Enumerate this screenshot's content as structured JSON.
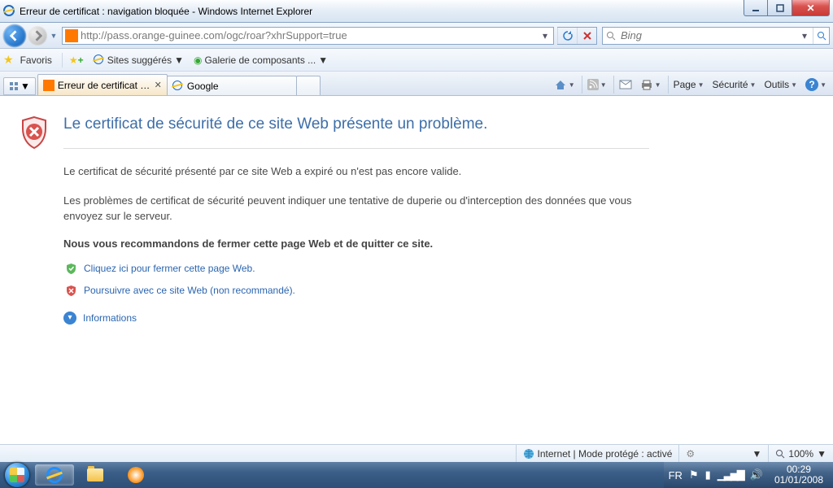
{
  "window": {
    "title": "Erreur de certificat : navigation bloquée - Windows Internet Explorer"
  },
  "nav": {
    "url": "http://pass.orange-guinee.com/ogc/roar?xhrSupport=true",
    "search_placeholder": "Bing"
  },
  "favorites": {
    "label": "Favoris",
    "suggested": "Sites suggérés",
    "gallery": "Galerie de composants ..."
  },
  "tabs": {
    "active": "Erreur de certificat : nav...",
    "second": "Google"
  },
  "commands": {
    "page": "Page",
    "security": "Sécurité",
    "tools": "Outils"
  },
  "cert": {
    "heading": "Le certificat de sécurité de ce site Web présente un problème.",
    "p1": "Le certificat de sécurité présenté par ce site Web a expiré ou n'est pas encore valide.",
    "p2": "Les problèmes de certificat de sécurité peuvent indiquer une tentative de duperie ou d'interception des données que vous envoyez sur le serveur.",
    "recommend": "Nous vous recommandons de fermer cette page Web et de quitter ce site.",
    "close_link": "Cliquez ici pour fermer cette page Web.",
    "continue_link": "Poursuivre avec ce site Web (non recommandé).",
    "info": "Informations"
  },
  "status": {
    "zone": "Internet | Mode protégé : activé",
    "zoom": "100%"
  },
  "tray": {
    "lang": "FR",
    "time": "00:29",
    "date": "01/01/2008"
  }
}
